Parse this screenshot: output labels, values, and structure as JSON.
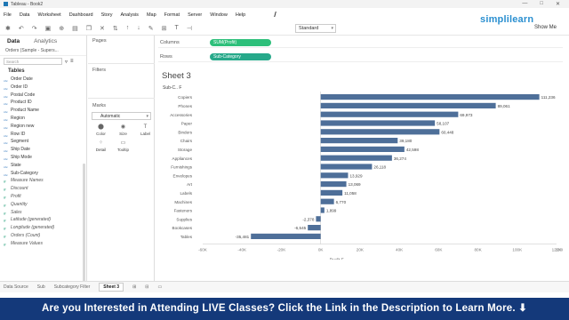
{
  "window": {
    "title": "Tableau - Book2",
    "controls": [
      "—",
      "□",
      "✕"
    ]
  },
  "menu": [
    "File",
    "Data",
    "Worksheet",
    "Dashboard",
    "Story",
    "Analysis",
    "Map",
    "Format",
    "Server",
    "Window",
    "Help"
  ],
  "brand": "simplilearn",
  "toolbar": {
    "fit": "Standard",
    "show_me": "Show Me"
  },
  "data_pane": {
    "tabs": [
      "Data",
      "Analytics"
    ],
    "datasource": "Orders (Sample - Supers...",
    "search_placeholder": "Search",
    "tables_header": "Tables",
    "dimensions": [
      "Order Date",
      "Order ID",
      "Postal Code",
      "Product ID",
      "Product Name",
      "Region",
      "Region new",
      "Row ID",
      "Segment",
      "Ship Date",
      "Ship Mode",
      "State",
      "Sub-Category"
    ],
    "measures": [
      "Measure Names",
      "Discount",
      "Profit",
      "Quantity",
      "Sales",
      "Latitude (generated)",
      "Longitude (generated)",
      "Orders (Count)",
      "Measure Values"
    ]
  },
  "cards": {
    "pages": "Pages",
    "filters": "Filters",
    "marks": "Marks",
    "mark_type": "Automatic",
    "mark_buttons": [
      "Color",
      "Size",
      "Label",
      "Detail",
      "Tooltip"
    ]
  },
  "shelves": {
    "columns_label": "Columns",
    "columns_pill": "SUM(Profit)",
    "rows_label": "Rows",
    "rows_pill": "Sub-Category"
  },
  "sheet": {
    "title": "Sheet 3",
    "header": "Sub-C..  F"
  },
  "chart_data": {
    "type": "bar",
    "orientation": "horizontal",
    "categories": [
      "Copiers",
      "Phones",
      "Accessories",
      "Paper",
      "Binders",
      "Chairs",
      "Storage",
      "Appliances",
      "Furnishings",
      "Envelopes",
      "Art",
      "Labels",
      "Machines",
      "Fasteners",
      "Supplies",
      "Bookcases",
      "Tables"
    ],
    "values": [
      111236,
      89061,
      69973,
      58107,
      60448,
      39180,
      42598,
      36274,
      26118,
      13929,
      13069,
      11058,
      6770,
      1899,
      -2378,
      -6545,
      -35481
    ],
    "value_labels": [
      "111,236",
      "89,061",
      "69,973",
      "58,107",
      "60,448",
      "39,180",
      "42,598",
      "36,274",
      "26,118",
      "13,929",
      "13,069",
      "11,058",
      "6,770",
      "1,899",
      "-2,378",
      "-6,545",
      "-35,481"
    ],
    "xlabel": "Profit  F",
    "xlim": [
      -60000,
      120000
    ],
    "xticks": [
      -60000,
      -40000,
      -20000,
      0,
      20000,
      40000,
      60000,
      80000,
      100000,
      120000
    ],
    "xtick_labels": [
      "-60K",
      "-40K",
      "-20K",
      "0K",
      "20K",
      "40K",
      "60K",
      "80K",
      "100K",
      "120K",
      "130K"
    ],
    "color": "#4e6f99"
  },
  "sheet_tabs": [
    "Data Source",
    "Sub",
    "Subcategory Filter",
    "Sheet 3"
  ],
  "banner": "Are you Interested in Attending LIVE Classes? Click the Link in the Description to Learn More. ⬇"
}
